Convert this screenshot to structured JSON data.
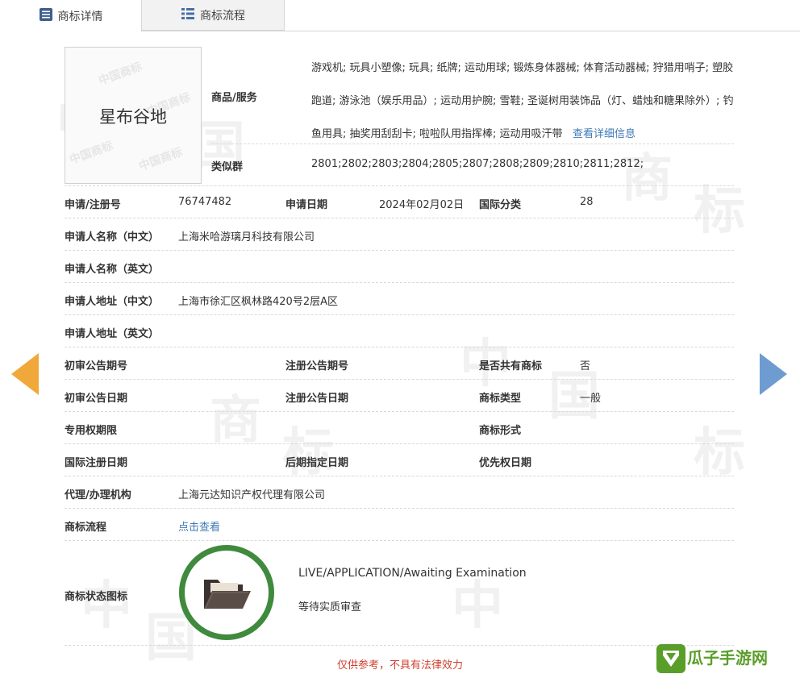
{
  "tabs": [
    {
      "label": "商标详情",
      "icon": "list-icon"
    },
    {
      "label": "商标流程",
      "icon": "grid-icon"
    }
  ],
  "trademark": {
    "name": "星布谷地",
    "watermark": "中国商标"
  },
  "goods": {
    "label": "商品/服务",
    "text": "游戏机; 玩具小塑像; 玩具; 纸牌; 运动用球; 锻炼身体器械; 体育活动器械; 狩猎用哨子; 塑胶跑道; 游泳池（娱乐用品）; 运动用护腕; 雪鞋; 圣诞树用装饰品（灯、蜡烛和糖果除外）; 钓鱼用具; 抽奖用刮刮卡; 啦啦队用指挥棒; 运动用吸汗带",
    "detail_link": "查看详细信息"
  },
  "similar": {
    "label": "类似群",
    "value": "2801;2802;2803;2804;2805;2807;2808;2809;2810;2811;2812;"
  },
  "fields": {
    "reg_no_label": "申请/注册号",
    "reg_no": "76747482",
    "app_date_label": "申请日期",
    "app_date": "2024年02月02日",
    "intl_class_label": "国际分类",
    "intl_class": "28",
    "applicant_cn_label": "申请人名称（中文）",
    "applicant_cn": "上海米哈游璃月科技有限公司",
    "applicant_en_label": "申请人名称（英文）",
    "address_cn_label": "申请人地址（中文）",
    "address_cn": "上海市徐汇区枫林路420号2层A区",
    "address_en_label": "申请人地址（英文）",
    "prelim_no_label": "初审公告期号",
    "reg_pub_no_label": "注册公告期号",
    "shared_label": "是否共有商标",
    "shared": "否",
    "prelim_date_label": "初审公告日期",
    "reg_pub_date_label": "注册公告日期",
    "tm_type_label": "商标类型",
    "tm_type": "一般",
    "exclusive_label": "专用权期限",
    "tm_form_label": "商标形式",
    "intl_reg_date_label": "国际注册日期",
    "later_date_label": "后期指定日期",
    "priority_date_label": "优先权日期",
    "agency_label": "代理/办理机构",
    "agency": "上海元达知识产权代理有限公司",
    "process_label": "商标流程",
    "process_link": "点击查看",
    "status_icon_label": "商标状态图标"
  },
  "status": {
    "en": "LIVE/APPLICATION/Awaiting Examination",
    "cn": "等待实质审查",
    "ring_color": "#3f8a3d"
  },
  "disclaimer": "仅供参考，不具有法律效力",
  "brand_logo": "瓜子手游网",
  "colors": {
    "left_arrow": "#f0a83a",
    "right_arrow": "#6e9bd0",
    "link": "#3d7ab5",
    "disclaimer": "#d0402f",
    "logo": "#5a9e2a"
  }
}
